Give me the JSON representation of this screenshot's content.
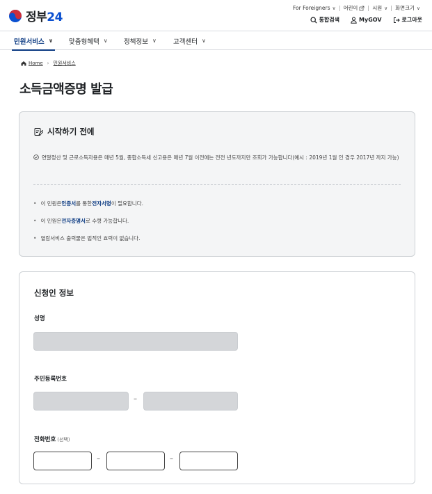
{
  "header": {
    "logo_text": "정부",
    "logo_num": "24",
    "util_top": [
      {
        "label": "For Foreigners"
      },
      {
        "label": "어린이"
      },
      {
        "label": "시원"
      },
      {
        "label": "화면크기"
      }
    ],
    "util_bottom": {
      "search": "통합검색",
      "mygov": "MyGOV",
      "logout": "로그아웃"
    }
  },
  "gnb": [
    "민원서비스",
    "맞춤형혜택",
    "정책정보",
    "고객센터"
  ],
  "breadcrumb": {
    "home": "Home",
    "current": "민원서비스"
  },
  "page_title": "소득금액증명 발급",
  "start_box": {
    "title": "시작하기 전에",
    "notice": "연말정산 및 근로소득자용은 매년 5월, 종합소득세 신고용은 매년 7월 이전에는 전전 년도까지만 조회가 가능합니다(예시 : 2019년 1월 인 경우 2017년 까지 가능)",
    "bullet1": {
      "pre": "이 민원은 ",
      "s1": "인증서",
      "mid": "를 통한 ",
      "s2": "전자서명",
      "post": "이 필요합니다."
    },
    "bullet2": {
      "pre": "이 민원은 ",
      "s1": "전자증명서",
      "post": "로 수령 가능합니다."
    },
    "bullet3": "열람서비스 출력물은 법적인 효력이 없습니다."
  },
  "apply_box": {
    "title": "신청인 정보",
    "name_label": "성명",
    "rrn_label": "주민등록번호",
    "phone_label": "전화번호",
    "phone_optional": "(선택)",
    "dash": "–"
  },
  "colors": {
    "brand_blue": "#0b3a82",
    "logo_blue": "#0b50d0",
    "logo_red": "#cd2e3a"
  }
}
